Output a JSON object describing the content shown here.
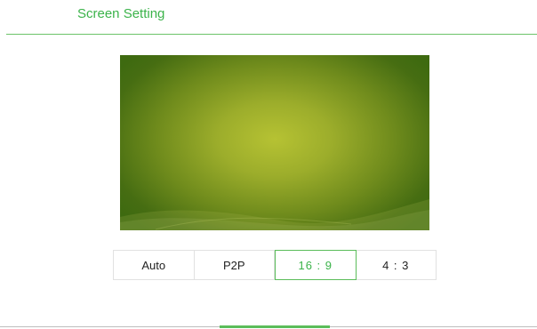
{
  "header": {
    "title": "Screen Setting"
  },
  "preview": {
    "description_icon": "wallpaper-preview"
  },
  "ratio_options": [
    {
      "label": "Auto",
      "selected": false
    },
    {
      "label": "P2P",
      "selected": false
    },
    {
      "label": "16 : 9",
      "selected": true
    },
    {
      "label": "4 : 3",
      "selected": false
    }
  ],
  "colors": {
    "accent": "#3bb34a",
    "divider": "#6cc36a",
    "preview_center": "#b6c233",
    "preview_edge": "#3e6a10"
  }
}
